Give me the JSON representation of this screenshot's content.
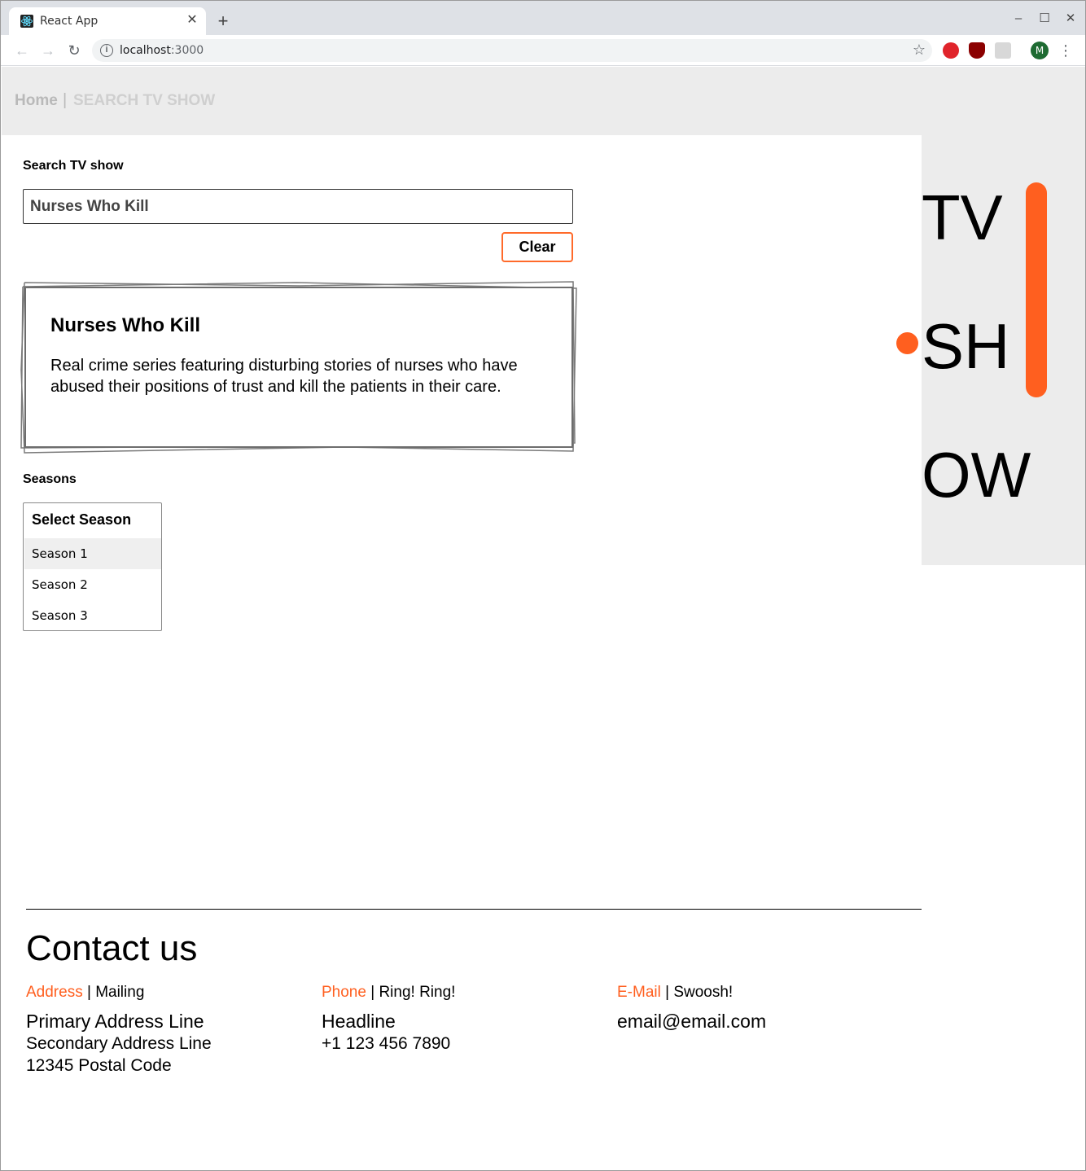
{
  "browser": {
    "tab_title": "React App",
    "url_host": "localhost",
    "url_port": ":3000",
    "profile_initial": "M"
  },
  "nav": {
    "home": "Home",
    "separator": "|",
    "search": "SEARCH TV SHOW"
  },
  "side_banner": {
    "lines": [
      "TV",
      "SH",
      "OW"
    ],
    "accent_color": "#ff5f1f"
  },
  "search": {
    "label": "Search TV show",
    "value": "Nurses Who Kill",
    "clear_label": "Clear"
  },
  "show": {
    "title": "Nurses Who Kill",
    "description": "Real crime series featuring disturbing stories of nurses who have abused their positions of trust and kill the patients in their care."
  },
  "seasons": {
    "label": "Seasons",
    "header": "Select Season",
    "options": [
      "Season 1",
      "Season 2",
      "Season 3"
    ],
    "highlighted": "Season 1"
  },
  "footer": {
    "title": "Contact us",
    "address": {
      "accent": "Address",
      "rest": " | Mailing",
      "line1": "Primary Address Line",
      "line2": "Secondary Address Line",
      "line3": "12345 Postal Code"
    },
    "phone": {
      "accent": "Phone",
      "rest": " | Ring! Ring!",
      "line1": "Headline",
      "line2": "+1 123 456 7890"
    },
    "email": {
      "accent": "E-Mail",
      "rest": " | Swoosh!",
      "line1": "email@email.com"
    }
  }
}
